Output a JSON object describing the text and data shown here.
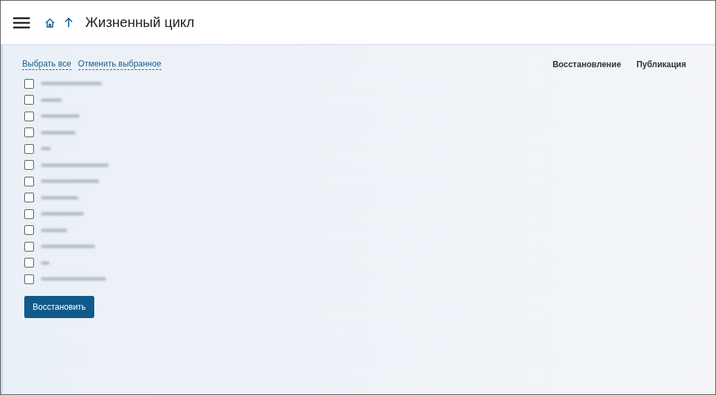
{
  "header": {
    "title": "Жизненный цикл"
  },
  "links": [
    "Выбрать все",
    "Отменить выбранное"
  ],
  "columns": [
    "Восстановление",
    "Публикация"
  ],
  "items": [
    {
      "checked": false
    },
    {
      "checked": false
    },
    {
      "checked": false
    },
    {
      "checked": false
    },
    {
      "checked": false
    },
    {
      "checked": false
    },
    {
      "checked": false
    },
    {
      "checked": false
    },
    {
      "checked": false
    },
    {
      "checked": false
    },
    {
      "checked": false
    },
    {
      "checked": false
    },
    {
      "checked": false
    }
  ],
  "button": "Восстановить"
}
